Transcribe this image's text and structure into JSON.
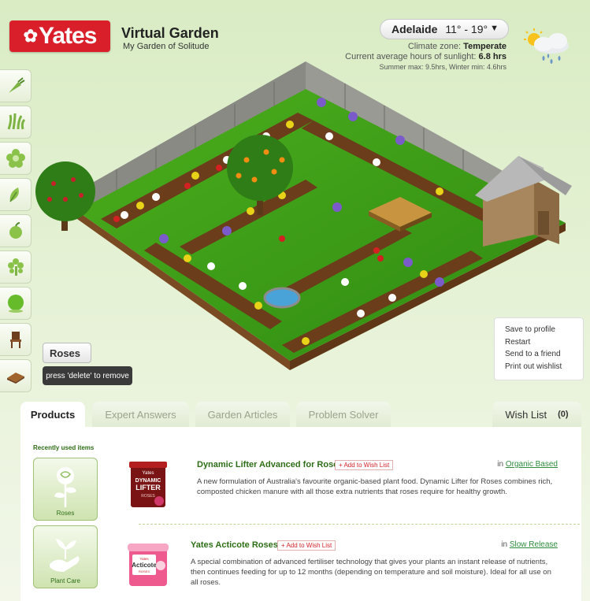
{
  "brand": {
    "logo_text": "Yates",
    "accent": "#d81f2a"
  },
  "header": {
    "title": "Virtual Garden",
    "subtitle": "My Garden of Solitude"
  },
  "weather": {
    "city": "Adelaide",
    "temp": "11° - 19°",
    "climate_label": "Climate zone:",
    "climate_value": "Temperate",
    "sun_label": "Current average hours of sunlight:",
    "sun_value": "6.8 hrs",
    "summer_winter": "Summer max: 9.5hrs, Winter min: 4.6hrs",
    "icon": "sun-cloud-rain-icon"
  },
  "tools": [
    "carrot-icon",
    "grass-icon",
    "flower-icon",
    "leaf-icon",
    "apple-icon",
    "tree-icon",
    "shrub-icon",
    "chair-icon",
    "paving-icon"
  ],
  "selection": {
    "name": "Roses",
    "hint": "press 'delete' to remove"
  },
  "actions": [
    "Save to profile",
    "Restart",
    "Send to a friend",
    "Print out wishlist"
  ],
  "tabs": [
    "Products",
    "Expert Answers",
    "Garden Articles",
    "Problem Solver"
  ],
  "wishlist": {
    "label": "Wish List",
    "count": "(0)"
  },
  "recent": {
    "label": "Recently used items",
    "items": [
      "Roses",
      "Plant Care"
    ]
  },
  "products": [
    {
      "name": "Dynamic Lifter Advanced for Roses",
      "add": "+ Add to Wish List",
      "in": "in",
      "category": "Organic Based",
      "desc": "A new formulation of Australia's favourite organic-based plant food. Dynamic Lifter for Roses combines rich, composted chicken manure with all those extra nutrients that roses require for healthy growth.",
      "pack_text": [
        "Yates",
        "DYNAMIC",
        "LIFTER",
        "ROSES"
      ]
    },
    {
      "name": "Yates Acticote Roses",
      "add": "+ Add to Wish List",
      "in": "in",
      "category": "Slow Release",
      "desc": "A special combination of advanced fertiliser technology that gives your plants an instant release of nutrients, then continues feeding for up to 12 months (depending on temperature and soil moisture). Ideal for all use on all roses.",
      "pack_text": [
        "Yates",
        "Acticote",
        "ROSES"
      ]
    }
  ]
}
